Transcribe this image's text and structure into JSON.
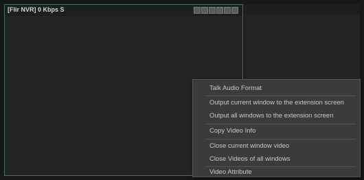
{
  "pane": {
    "title": "[Flir NVR]  0 Kbps  S",
    "toolbar_icons": [
      "snapshot-icon",
      "record-icon",
      "audio-icon",
      "zoom-icon",
      "ptz-icon",
      "close-icon"
    ]
  },
  "context_menu": {
    "items": [
      "Talk Audio Format",
      "Output current window to the extension screen",
      "Output all windows to the extension screen",
      "Copy Video Info",
      "Close current window video",
      "Close Videos of all windows",
      "Video Attribute"
    ]
  },
  "colors": {
    "active_border": "#3a7a55",
    "menu_bg": "#3b3b3b",
    "menu_text": "#c9c9c9"
  }
}
